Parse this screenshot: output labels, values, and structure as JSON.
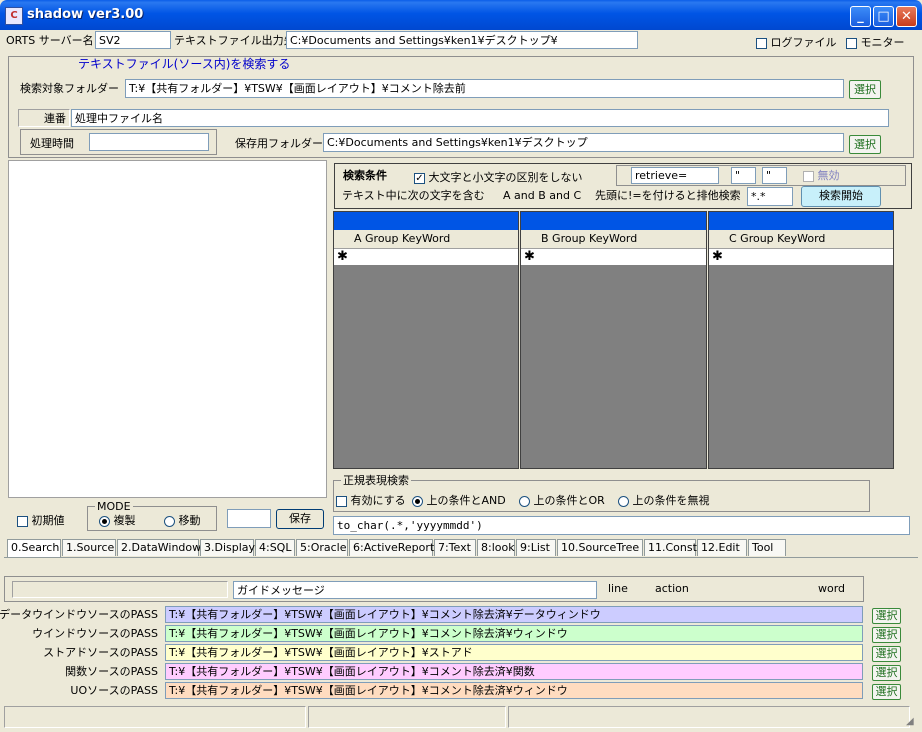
{
  "window": {
    "title": "shadow ver3.00",
    "icon": "C"
  },
  "top": {
    "server_label": "ORTS サーバー名",
    "server_value": "SV2",
    "output_label": "テキストファイル出力先",
    "output_value": "C:¥Documents and Settings¥ken1¥デスクトップ¥",
    "log_label": "ログファイル",
    "monitor_label": "モニター"
  },
  "search_group": {
    "title": "テキストファイル(ソース内)を検索する",
    "target_label": "検索対象フォルダー",
    "target_value": "T:¥【共有フォルダー】¥TSW¥【画面レイアウト】¥コメント除去前",
    "select_label": "選択",
    "seq_label": "連番",
    "processing_value": "処理中ファイル名",
    "time_label": "処理時間",
    "time_value": "",
    "save_folder_label": "保存用フォルダー",
    "save_folder_value": "C:¥Documents and Settings¥ken1¥デスクトップ"
  },
  "conditions": {
    "title": "検索条件",
    "case_label": "大文字と小文字の区別をしない",
    "retrieve_value": "retrieve=",
    "quote1": "\"",
    "quote2": "\"",
    "disable_label": "無効",
    "contains_label": "テキスト中に次の文字を含む",
    "abc_label": "A and B and C",
    "exclude_label": "先頭に!=を付けると排他検索",
    "pattern_value": "*.*",
    "start_label": "検索開始"
  },
  "grids": [
    {
      "header": "A Group KeyWord",
      "new_row": "✱"
    },
    {
      "header": "B Group KeyWord",
      "new_row": "✱"
    },
    {
      "header": "C Group KeyWord",
      "new_row": "✱"
    }
  ],
  "regex": {
    "title": "正規表現検索",
    "enable_label": "有効にする",
    "and_label": "上の条件とAND",
    "or_label": "上の条件とOR",
    "ignore_label": "上の条件を無視",
    "expr_value": "to_char(.*,'yyyymmdd')"
  },
  "left_bottom": {
    "init_label": "初期値",
    "mode_title": "MODE",
    "copy_label": "複製",
    "move_label": "移動",
    "save_label": "保存",
    "small_value": ""
  },
  "tabs": [
    "0.Search",
    "1.Source",
    "2.DataWindow",
    "3.Display",
    "4:SQL",
    "5:Oracle",
    "6:ActiveReport",
    "7:Text",
    "8:look",
    "9:List",
    "10.SourceTree",
    "11.Const",
    "12.Edit",
    "Tool"
  ],
  "bottom": {
    "guide_value": "ガイドメッセージ",
    "col_line": "line",
    "col_action": "action",
    "col_word": "word",
    "paths": [
      {
        "label": "データウインドウソースのPASS",
        "value": "T:¥【共有フォルダー】¥TSW¥【画面レイアウト】¥コメント除去済¥データウィンドウ",
        "color": "#ccccff"
      },
      {
        "label": "ウインドウソースのPASS",
        "value": "T:¥【共有フォルダー】¥TSW¥【画面レイアウト】¥コメント除去済¥ウィンドウ",
        "color": "#ccffcc"
      },
      {
        "label": "ストアドソースのPASS",
        "value": "T:¥【共有フォルダー】¥TSW¥【画面レイアウト】¥ストアド",
        "color": "#ffffcc"
      },
      {
        "label": "関数ソースのPASS",
        "value": "T:¥【共有フォルダー】¥TSW¥【画面レイアウト】¥コメント除去済¥関数",
        "color": "#ffccff"
      },
      {
        "label": "UOソースのPASS",
        "value": "T:¥【共有フォルダー】¥TSW¥【画面レイアウト】¥コメント除去済¥ウィンドウ",
        "color": "#ffdcc0"
      }
    ],
    "select_label": "選択"
  }
}
